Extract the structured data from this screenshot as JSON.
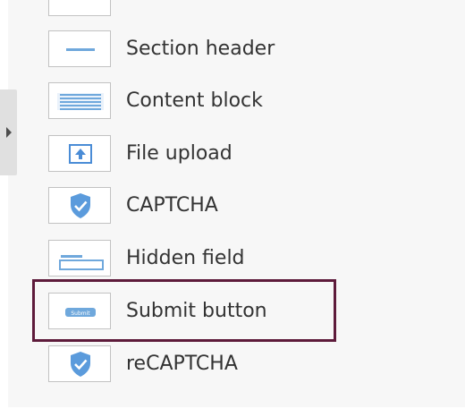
{
  "palette": {
    "icon_blue": "#6fa8dc",
    "icon_blue_dark": "#4a8cd6",
    "highlight": "#5e1b3b",
    "label_text": "#333333"
  },
  "form_elements": [
    {
      "label": "Section header",
      "icon": "section-header-icon"
    },
    {
      "label": "Content block",
      "icon": "content-block-icon"
    },
    {
      "label": "File upload",
      "icon": "file-upload-icon"
    },
    {
      "label": "CAPTCHA",
      "icon": "shield-check-icon"
    },
    {
      "label": "Hidden field",
      "icon": "hidden-field-icon"
    },
    {
      "label": "Submit button",
      "icon": "submit-button-icon",
      "highlighted": true
    },
    {
      "label": "reCAPTCHA",
      "icon": "shield-check-icon"
    }
  ],
  "submit_icon_text": "Submit"
}
